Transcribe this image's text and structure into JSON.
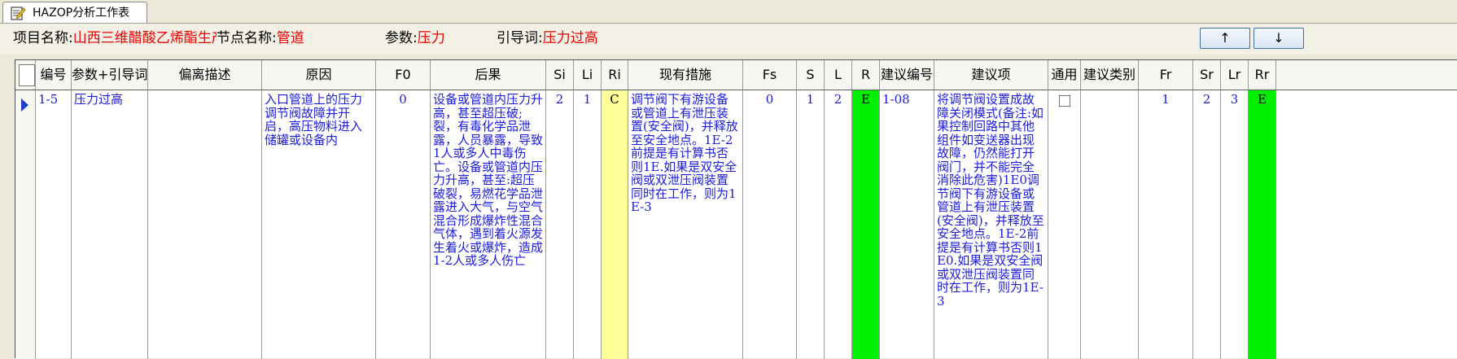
{
  "window": {
    "tab_title": "HAZOP分析工作表",
    "tab_icon": "worksheet-edit-icon"
  },
  "header": {
    "project_label": "项目名称:",
    "project_value": "山西三维醋酸乙烯酯生产",
    "node_label": "节点名称:",
    "node_value": "管道",
    "param_label": "参数:",
    "param_value": "压力",
    "guideword_label": "引导词:",
    "guideword_value": "压力过高",
    "up_button": "↑",
    "down_button": "↓"
  },
  "colors": {
    "value_red": "#e60000",
    "cell_blue": "#1c1cd6",
    "risk_yellow": "#ffff99",
    "risk_green": "#00ee00"
  },
  "grid": {
    "columns": [
      "编号",
      "参数+引导词",
      "偏离描述",
      "原因",
      "F0",
      "后果",
      "Si",
      "Li",
      "Ri",
      "现有措施",
      "Fs",
      "S",
      "L",
      "R",
      "建议编号",
      "建议项",
      "通用",
      "建议类别",
      "Fr",
      "Sr",
      "Lr",
      "Rr"
    ],
    "row": {
      "id": "1-5",
      "param_guideword": "压力过高",
      "deviation": "",
      "cause": "入口管道上的压力调节阀故障并开启，高压物料进入储罐或设备内",
      "f0": "0",
      "consequence": "设备或管道内压力升高，甚至超压破;裂，有毒化学品泄露，人员暴露，导致1人或多人中毒伤亡。设备或管道内压力升高，甚至:超压破裂，易燃花学品泄露进入大气，与空气混合形成爆炸性混合气体，遇到着火源发生着火或爆炸，造成1-2人或多人伤亡",
      "si": "2",
      "li": "1",
      "ri": "C",
      "measures": "调节阀下有游设备或管道上有泄压装置(安全阀)，并释放至安全地点。1E-2前提是有计算书否则1E.如果是双安全阀或双泄压阀装置同时在工作，则为1E-3",
      "fs": "0",
      "s": "1",
      "l": "2",
      "r": "E",
      "suggestion_id": "1-08",
      "suggestion": "将调节阀设置成故障关闭模式(备注:如果控制回路中其他组件如变送器出现故障，仍然能打开阀门，并不能完全消除此危害)1E0调节阀下有游设备或管道上有泄压装置(安全阀)，并释放至安全地点。1E-2前提是有计算书否则1E0.如果是双安全阀或双泄压阀装置同时在工作，则为1E-3",
      "general_checked": false,
      "suggestion_category": "",
      "fr": "1",
      "sr": "2",
      "lr": "3",
      "rr": "E"
    }
  }
}
